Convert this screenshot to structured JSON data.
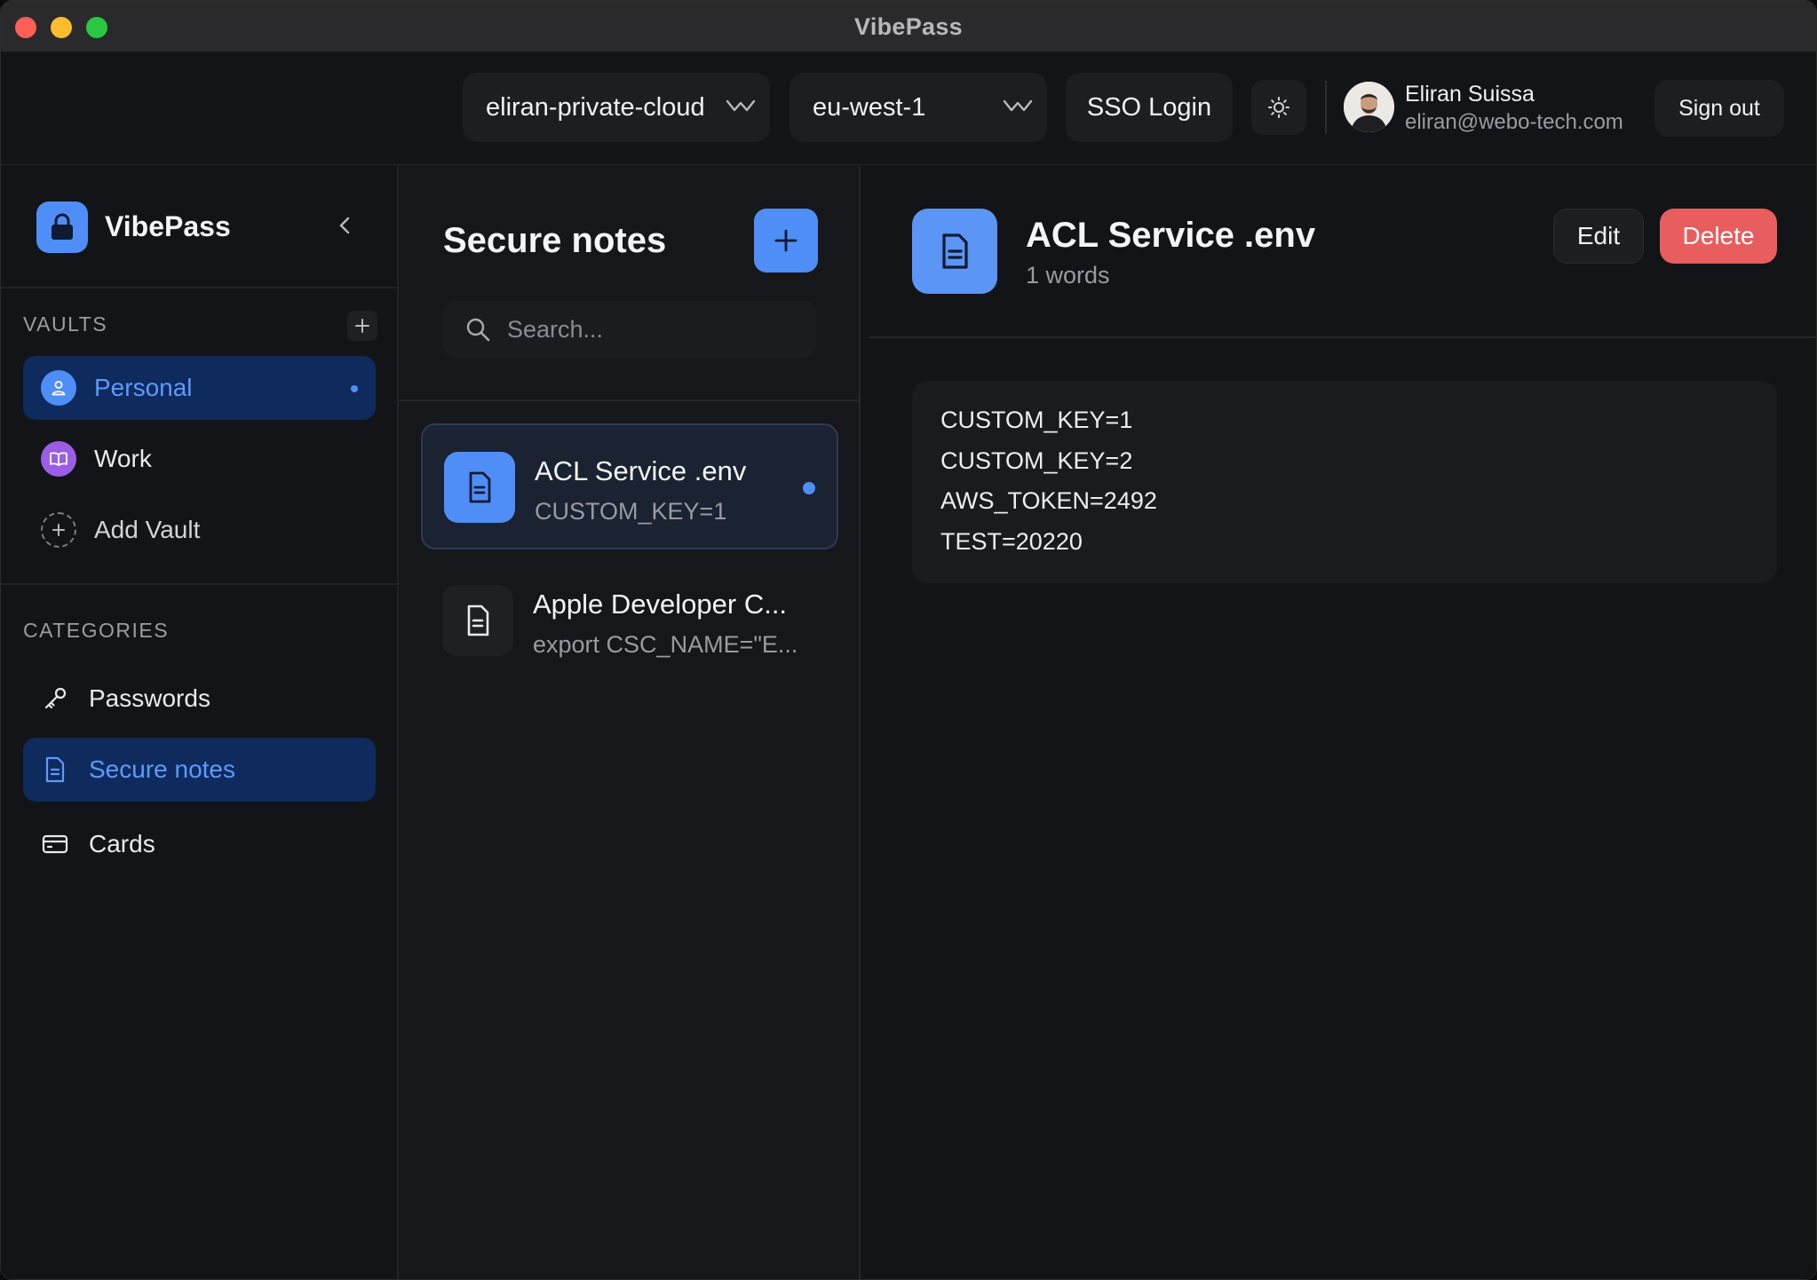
{
  "window": {
    "title": "VibePass"
  },
  "toolbar": {
    "profile_select": "eliran-private-cloud",
    "region_select": "eu-west-1",
    "sso_label": "SSO Login",
    "user_name": "Eliran Suissa",
    "user_email": "eliran@webo-tech.com",
    "signout_label": "Sign out"
  },
  "sidebar": {
    "brand": "VibePass",
    "vaults_label": "VAULTS",
    "vaults": [
      {
        "label": "Personal",
        "icon": "person-icon",
        "active": true
      },
      {
        "label": "Work",
        "icon": "book-icon",
        "active": false
      },
      {
        "label": "Add Vault",
        "icon": "plus-circle-icon",
        "active": false
      }
    ],
    "categories_label": "CATEGORIES",
    "categories": [
      {
        "label": "Passwords",
        "icon": "key-icon",
        "active": false
      },
      {
        "label": "Secure notes",
        "icon": "document-icon",
        "active": true
      },
      {
        "label": "Cards",
        "icon": "card-icon",
        "active": false
      }
    ]
  },
  "list": {
    "title": "Secure notes",
    "search_placeholder": "Search...",
    "notes": [
      {
        "title": "ACL Service .env",
        "snippet": "CUSTOM_KEY=1",
        "active": true
      },
      {
        "title": "Apple Developer C...",
        "snippet": "export CSC_NAME=\"E...",
        "active": false
      }
    ]
  },
  "detail": {
    "title": "ACL Service .env",
    "subtitle": "1 words",
    "edit_label": "Edit",
    "delete_label": "Delete",
    "content_lines": [
      "CUSTOM_KEY=1",
      "CUSTOM_KEY=2",
      "AWS_TOKEN=2492",
      "TEST=20220"
    ]
  },
  "colors": {
    "accent": "#4f8ef7",
    "danger": "#e85d5d",
    "active_nav_bg": "#0f2a5c",
    "work_vault": "#9b5de5"
  }
}
